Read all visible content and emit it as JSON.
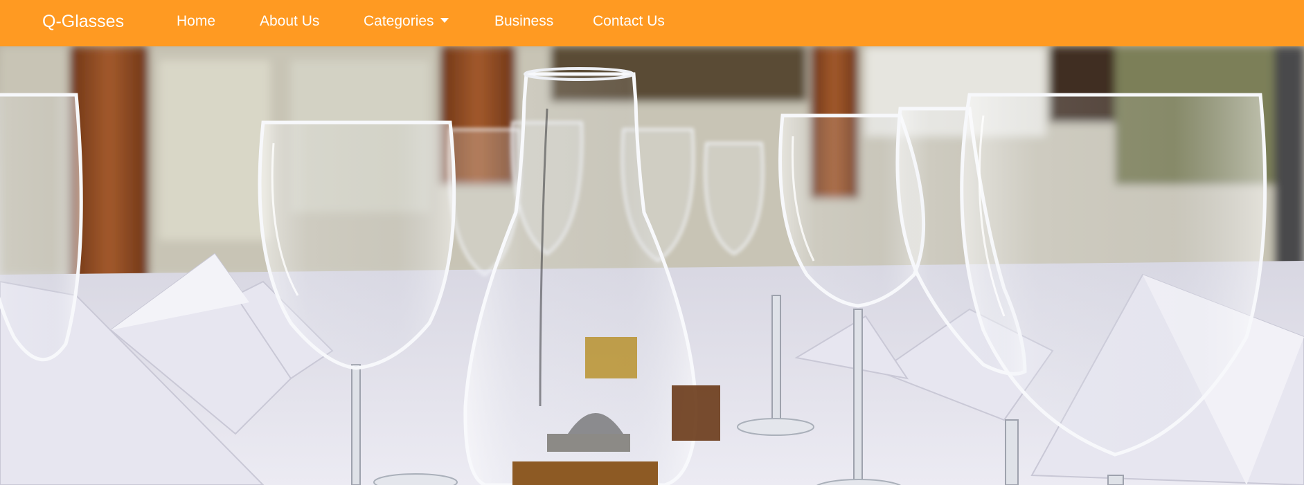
{
  "navbar": {
    "brand": "Q-Glasses",
    "background_color": "#ff9a22",
    "text_color": "#ffffff",
    "items": [
      {
        "label": "Home"
      },
      {
        "label": "About Us"
      },
      {
        "label": "Categories",
        "icon": "caret-down-icon"
      },
      {
        "label": "Business"
      },
      {
        "label": "Contact Us"
      }
    ]
  },
  "hero": {
    "image": "wine-glasses-on-dining-table-photo",
    "palette": {
      "tablecloth": "#dcdbe8",
      "wood": "#8a4a22",
      "background_blur": "#c9c7bf"
    }
  }
}
